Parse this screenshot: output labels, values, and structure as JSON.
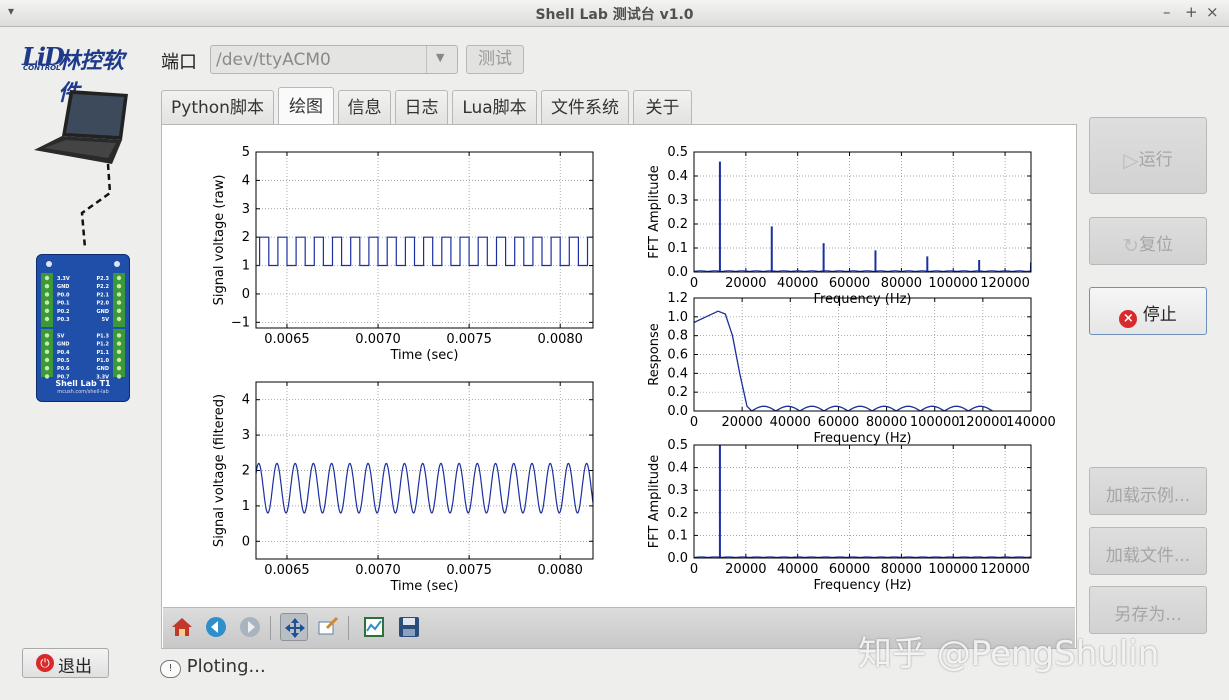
{
  "window": {
    "title": "Shell Lab 测试台 v1.0"
  },
  "logo": {
    "mark": "LiD",
    "brand": "林控软件",
    "sub": "CONTROL"
  },
  "board": {
    "name": "Shell Lab T1",
    "url": "mcush.com/shell-lab",
    "left_pins": [
      "3.3V",
      "GND",
      "P0.0",
      "P0.1",
      "P0.2",
      "P0.3",
      "",
      "5V",
      "GND",
      "P0.4",
      "P0.5",
      "P0.6",
      "P0.7"
    ],
    "right_pins": [
      "P2.3",
      "P2.2",
      "P2.1",
      "P2.0",
      "GND",
      "5V",
      "",
      "P1.3",
      "P1.2",
      "P1.1",
      "P1.0",
      "GND",
      "3.3V"
    ]
  },
  "port": {
    "label": "端口",
    "value": "/dev/ttyACM0",
    "test_button": "测试"
  },
  "tabs": [
    {
      "label": "Python脚本",
      "active": false
    },
    {
      "label": "绘图",
      "active": true
    },
    {
      "label": "信息",
      "active": false
    },
    {
      "label": "日志",
      "active": false
    },
    {
      "label": "Lua脚本",
      "active": false
    },
    {
      "label": "文件系统",
      "active": false
    },
    {
      "label": "关于",
      "active": false
    }
  ],
  "right_buttons": {
    "run": "运行",
    "reset": "复位",
    "stop": "停止",
    "load_example": "加载示例...",
    "load_file": "加载文件...",
    "save_as": "另存为..."
  },
  "exit_button": "退出",
  "status_text": "Ploting...",
  "watermark": "知乎 @PengShulin",
  "toolbar_icons": [
    "home-icon",
    "back-icon",
    "forward-icon",
    "pan-icon",
    "zoom-icon",
    "subplots-icon",
    "save-icon"
  ],
  "chart_data": [
    {
      "type": "line",
      "ylabel": "Signal voltage (raw)",
      "xlabel": "Time (sec)",
      "xlim": [
        0.00633,
        0.00818
      ],
      "ylim": [
        -1.2,
        5
      ],
      "xticks": [
        0.0065,
        0.007,
        0.0075,
        0.008
      ],
      "xtick_labels": [
        "0.0065",
        "0.0070",
        "0.0075",
        "0.0080"
      ],
      "yticks": [
        -1,
        0,
        1,
        2,
        3,
        4,
        5
      ],
      "ytick_labels": [
        "−1",
        "0",
        "1",
        "2",
        "3",
        "4",
        "5"
      ],
      "grid": true,
      "signal": {
        "kind": "square",
        "low": 1,
        "high": 2,
        "frequency_hz": 10000,
        "phase_sec": 0.00635
      }
    },
    {
      "type": "line",
      "ylabel": "Signal voltage (filtered)",
      "xlabel": "Time (sec)",
      "xlim": [
        0.00633,
        0.00818
      ],
      "ylim": [
        -0.5,
        4.5
      ],
      "xticks": [
        0.0065,
        0.007,
        0.0075,
        0.008
      ],
      "xtick_labels": [
        "0.0065",
        "0.0070",
        "0.0075",
        "0.0080"
      ],
      "yticks": [
        0,
        1,
        2,
        3,
        4
      ],
      "ytick_labels": [
        "0",
        "1",
        "2",
        "3",
        "4"
      ],
      "grid": true,
      "signal": {
        "kind": "sine",
        "offset": 1.5,
        "amplitude": 0.7,
        "frequency_hz": 10000
      }
    },
    {
      "type": "line",
      "ylabel": "FFT Amplitude",
      "xlabel": "Frequency (Hz)",
      "xlim": [
        0,
        130000
      ],
      "ylim": [
        0,
        0.5
      ],
      "xticks": [
        0,
        20000,
        40000,
        60000,
        80000,
        100000,
        120000
      ],
      "xtick_labels": [
        "0",
        "20000",
        "40000",
        "60000",
        "80000",
        "100000",
        "120000"
      ],
      "yticks": [
        0,
        0.1,
        0.2,
        0.3,
        0.4,
        0.5
      ],
      "ytick_labels": [
        "0.0",
        "0.1",
        "0.2",
        "0.3",
        "0.4",
        "0.5"
      ],
      "grid": true,
      "peaks": [
        [
          10000,
          0.46
        ],
        [
          30000,
          0.19
        ],
        [
          50000,
          0.12
        ],
        [
          70000,
          0.09
        ],
        [
          90000,
          0.065
        ],
        [
          110000,
          0.05
        ],
        [
          130000,
          0.04
        ]
      ]
    },
    {
      "type": "line",
      "ylabel": "Response",
      "xlabel": "Frequency (Hz)",
      "xlim": [
        0,
        140000
      ],
      "ylim": [
        0,
        1.2
      ],
      "xticks": [
        0,
        20000,
        40000,
        60000,
        80000,
        100000,
        120000,
        140000
      ],
      "xtick_labels": [
        "0",
        "20000",
        "40000",
        "60000",
        "80000",
        "100000",
        "120000",
        "140000"
      ],
      "yticks": [
        0,
        0.2,
        0.4,
        0.6,
        0.8,
        1.0,
        1.2
      ],
      "ytick_labels": [
        "0.0",
        "0.2",
        "0.4",
        "0.6",
        "0.8",
        "1.0",
        "1.2"
      ],
      "grid": true,
      "response": {
        "passband": [
          [
            0,
            0.94
          ],
          [
            5000,
            1.0
          ],
          [
            10000,
            1.06
          ],
          [
            13000,
            1.03
          ],
          [
            16000,
            0.8
          ],
          [
            19000,
            0.4
          ],
          [
            22000,
            0.05
          ],
          [
            24000,
            0.0
          ]
        ],
        "sidelobe_start": 24000,
        "sidelobe_end": 124000,
        "sidelobe_period": 10000,
        "sidelobe_height": 0.05
      }
    },
    {
      "type": "line",
      "ylabel": "FFT Amplitude",
      "xlabel": "Frequency (Hz)",
      "xlim": [
        0,
        130000
      ],
      "ylim": [
        0,
        0.5
      ],
      "xticks": [
        0,
        20000,
        40000,
        60000,
        80000,
        100000,
        120000
      ],
      "xtick_labels": [
        "0",
        "20000",
        "40000",
        "60000",
        "80000",
        "100000",
        "120000"
      ],
      "yticks": [
        0,
        0.1,
        0.2,
        0.3,
        0.4,
        0.5
      ],
      "ytick_labels": [
        "0.0",
        "0.1",
        "0.2",
        "0.3",
        "0.4",
        "0.5"
      ],
      "grid": true,
      "peaks": [
        [
          10000,
          0.5
        ]
      ]
    }
  ]
}
